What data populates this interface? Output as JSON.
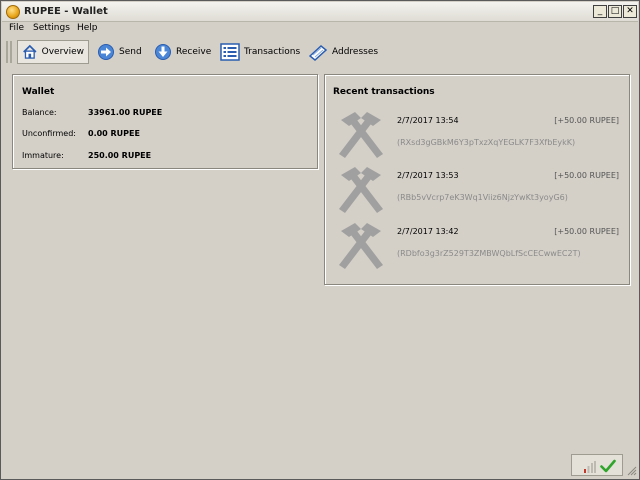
{
  "window": {
    "title": "RUPEE - Wallet",
    "min_glyph": "_",
    "max_glyph": "□",
    "close_glyph": "✕"
  },
  "menu": {
    "items": [
      "File",
      "Settings",
      "Help"
    ]
  },
  "toolbar": {
    "items": [
      {
        "label": "Overview",
        "icon": "home-icon",
        "active": true
      },
      {
        "label": "Send",
        "icon": "send-arrow-icon",
        "active": false
      },
      {
        "label": "Receive",
        "icon": "receive-arrow-icon",
        "active": false
      },
      {
        "label": "Transactions",
        "icon": "transactions-list-icon",
        "active": false
      },
      {
        "label": "Addresses",
        "icon": "address-book-icon",
        "active": false
      }
    ]
  },
  "wallet": {
    "title": "Wallet",
    "balance_label": "Balance:",
    "balance_value": "33961.00 RUPEE",
    "unconfirmed_label": "Unconfirmed:",
    "unconfirmed_value": "0.00 RUPEE",
    "immature_label": "Immature:",
    "immature_value": "250.00 RUPEE"
  },
  "recent": {
    "title": "Recent transactions",
    "transactions": [
      {
        "date": "2/7/2017 13:54",
        "amount": "[+50.00 RUPEE]",
        "address": "(RXsd3gGBkM6Y3pTxzXqYEGLK7F3XfbEykK)",
        "icon": "mining-hammers-icon"
      },
      {
        "date": "2/7/2017 13:53",
        "amount": "[+50.00 RUPEE]",
        "address": "(RBb5vVcrp7eK3Wq1Viiz6NjzYwKt3yoyG6)",
        "icon": "mining-hammers-icon"
      },
      {
        "date": "2/7/2017 13:42",
        "amount": "[+50.00 RUPEE]",
        "address": "(RDbfo3g3rZ529T3ZMBWQbLfScCECwwEC2T)",
        "icon": "mining-hammers-icon"
      }
    ]
  },
  "status": {
    "signal_icon": "connection-bars-icon",
    "sync_icon": "synced-check-icon"
  },
  "colors": {
    "accent_blue": "#2a5db0",
    "check_green": "#2fa52b",
    "muted_text": "#8a8a8a"
  }
}
